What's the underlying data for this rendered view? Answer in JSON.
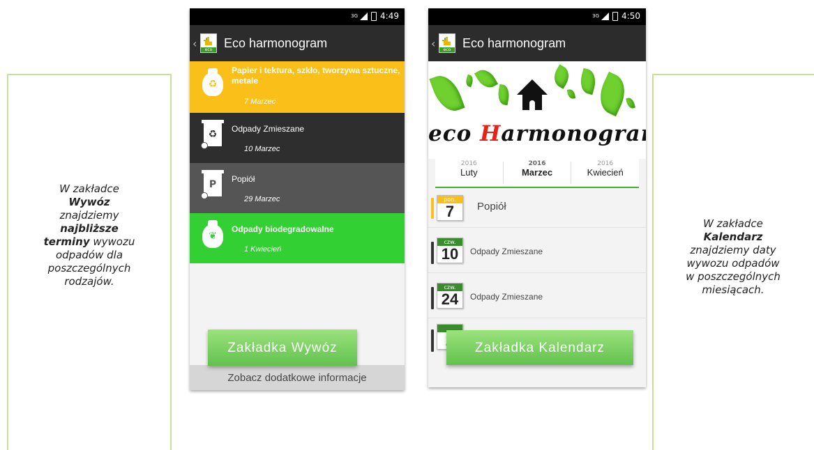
{
  "left_panel": {
    "line1": "W zakładce",
    "line2": "Wywóz",
    "line3": "znajdziemy",
    "line4": "najbliższe",
    "line5_bold": "terminy",
    "line5_rest": " wywozu",
    "line6": "odpadów dla",
    "line7": "poszczególnych",
    "line8": "rodzajów."
  },
  "right_panel": {
    "line1": "W zakładce",
    "line2": "Kalendarz",
    "line3": "znajdziemy daty",
    "line4": "wywozu odpadów",
    "line5": "w poszczególnych",
    "line6": "miesiącach."
  },
  "phone1": {
    "status": {
      "network": "3G",
      "time": "4:49"
    },
    "app_title": "Eco harmonogram",
    "logo_label": "eco",
    "items": [
      {
        "name": "Papier i tektura, szkło, tworzywa sztuczne, metale",
        "date": "7 Marzec",
        "icon": "recycle-bag-icon",
        "color": "#fbbf1a"
      },
      {
        "name": "Odpady Zmieszane",
        "date": "10 Marzec",
        "icon": "recycle-bin-icon",
        "color": "#2e2e2e"
      },
      {
        "name": "Popiół",
        "date": "29 Marzec",
        "icon": "ash-bin-icon",
        "color": "#555555"
      },
      {
        "name": "Odpady biodegradowalne",
        "date": "1 Kwiecień",
        "icon": "leaf-bag-icon",
        "color": "#33d033"
      }
    ],
    "bottom_link": "Zobacz dodatkowe informacje",
    "overlay_label": "Zakładka  Wywóz"
  },
  "phone2": {
    "status": {
      "network": "3G",
      "time": "4:50"
    },
    "app_title": "Eco harmonogram",
    "logo_label": "eco",
    "brand": {
      "part1": "eco ",
      "part2": "H",
      "part3": "armonogram"
    },
    "months": [
      {
        "year": "2016",
        "month": "Luty"
      },
      {
        "year": "2016",
        "month": "Marzec"
      },
      {
        "year": "2016",
        "month": "Kwiecień"
      }
    ],
    "active_month_index": 1,
    "entries": [
      {
        "weekday": "pon.",
        "day": "7",
        "label": "Popiół"
      },
      {
        "weekday": "czw.",
        "day": "10",
        "label": "Odpady Zmieszane"
      },
      {
        "weekday": "czw.",
        "day": "24",
        "label": "Odpady Zmieszane"
      },
      {
        "weekday": "",
        "day": "2",
        "label": ""
      }
    ],
    "overlay_label": "Zakładka  Kalendarz"
  },
  "colors": {
    "accent_green": "#3fb22b",
    "yellow": "#fbbf1a",
    "panel_border": "#c8df9a"
  }
}
